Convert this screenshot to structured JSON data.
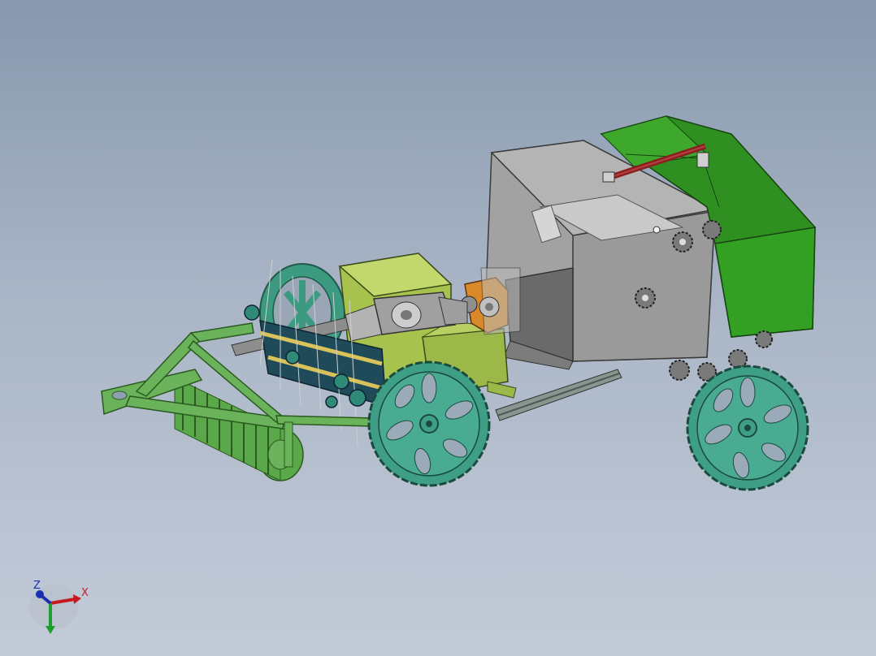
{
  "triad": {
    "x_label": "X",
    "z_label": "Z",
    "x_color": "#c8191e",
    "y_color": "#1e9e2c",
    "z_color": "#1b2fb5"
  },
  "colors": {
    "frame_green": "#6bb35a",
    "dark_green": "#2e8a1f",
    "olive_box": "#b5cf5a",
    "housing_gray": "#9d9d9d",
    "wheel_teal": "#3f9f86",
    "gearbox_orange": "#d98a2a",
    "hydraulic_red": "#8b1f1f"
  }
}
